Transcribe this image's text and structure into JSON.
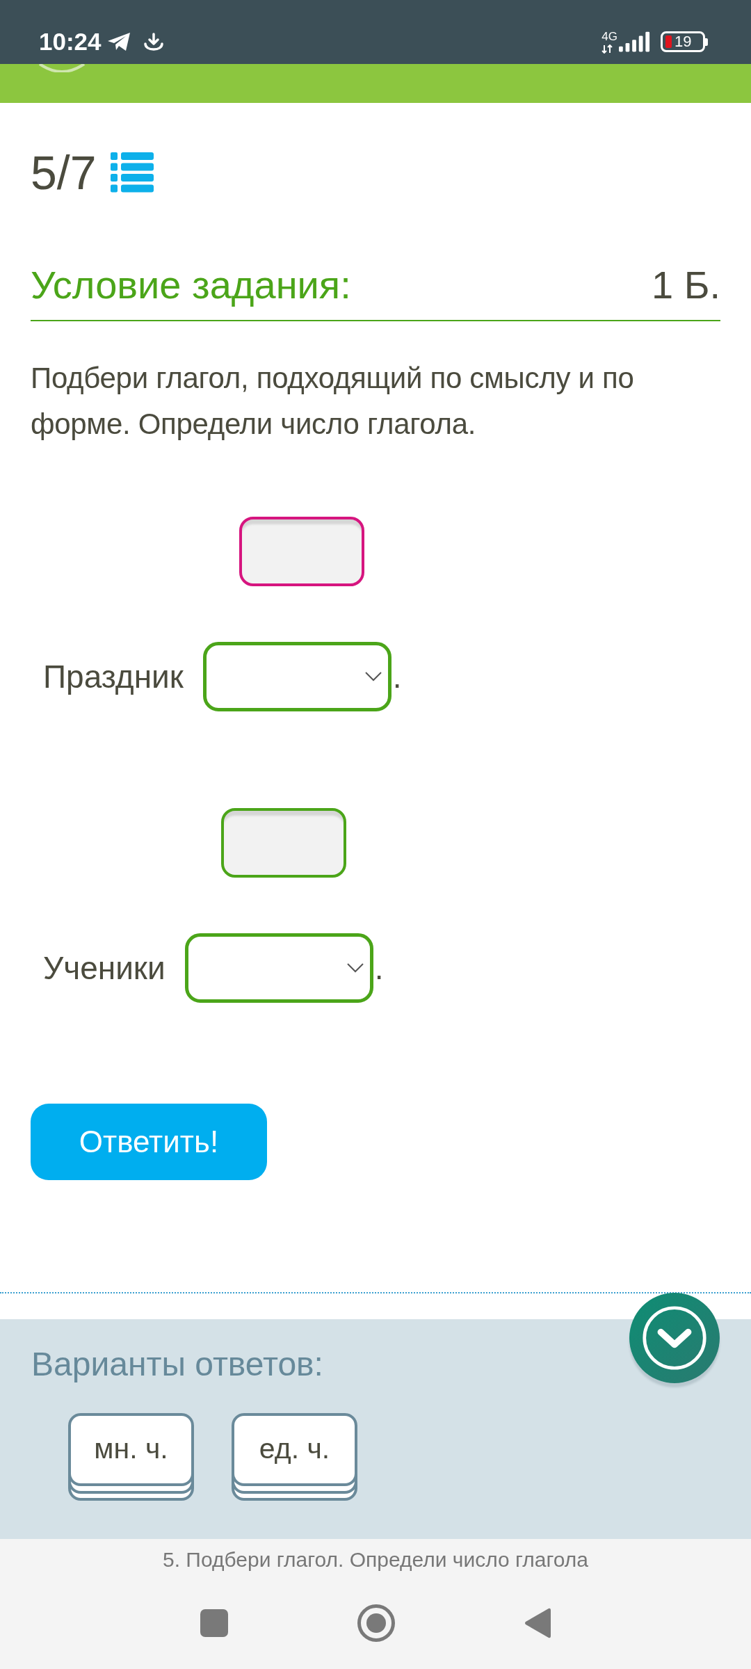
{
  "status_bar": {
    "time": "10:24",
    "network": "4G",
    "battery": "19"
  },
  "header": {
    "progress": "5/7"
  },
  "task": {
    "title": "Условие задания:",
    "points": "1 Б.",
    "instruction": "Подбери глагол, подходящий по смыслу и по форме. Определи число глагола."
  },
  "items": [
    {
      "label": "Праздник",
      "slot": {
        "selected": true
      },
      "end": "."
    },
    {
      "label": "Ученики",
      "slot": {
        "selected": false
      },
      "end": "."
    }
  ],
  "submit_button": "Ответить!",
  "answer_options": {
    "title": "Варианты ответов:",
    "options": [
      "мн. ч.",
      "ед. ч."
    ]
  },
  "footer": {
    "caption": "5. Подбери глагол. Определи число глагола"
  }
}
